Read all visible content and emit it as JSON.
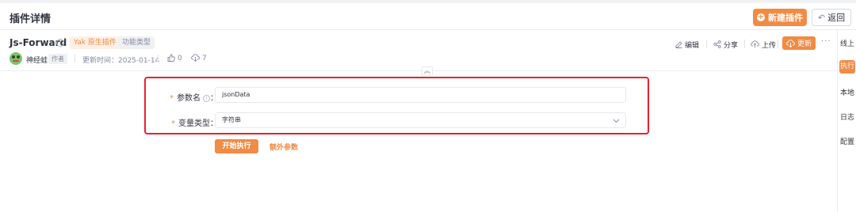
{
  "header": {
    "title": "插件详情",
    "new_plugin_label": "新建插件",
    "back_label": "返回"
  },
  "plugin": {
    "name": "Js-Forward",
    "tags": [
      "Yak 原生插件",
      "功能类型"
    ],
    "author": "神经蛙",
    "author_badge": "作者",
    "update_time": "更新时间：2025-01-14",
    "likes": "0",
    "downloads": "7"
  },
  "actions": {
    "edit": "编辑",
    "share": "分享",
    "upload": "上传",
    "update": "更新",
    "more": "···"
  },
  "side_tabs": [
    "线上",
    "执行",
    "本地",
    "日志",
    "配置"
  ],
  "active_side_tab": "执行",
  "form": {
    "param_name_label": "参数名",
    "param_name_value": "jsonData",
    "var_type_label": "变量类型",
    "var_type_value": "字符串",
    "colon": "："
  },
  "buttons": {
    "start": "开始执行",
    "extra_params": "额外参数"
  },
  "colors": {
    "accent": "#f28b44",
    "highlight_border": "#e8212b"
  }
}
